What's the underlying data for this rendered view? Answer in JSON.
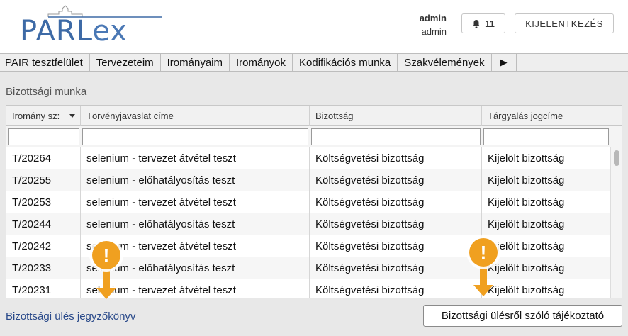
{
  "header": {
    "logo_text_main": "PARL",
    "logo_text_ex": "ex",
    "user_name": "admin",
    "user_role": "admin",
    "notification_count": "11",
    "logout_label": "KIJELENTKEZÉS",
    "icons": {
      "notification": "bell-icon",
      "logo": "parliament-building-icon"
    }
  },
  "nav": {
    "items": [
      "PAIR tesztfelület",
      "Tervezeteim",
      "Irományaim",
      "Irományok",
      "Kodifikációs munka",
      "Szakvélemények",
      "▶"
    ]
  },
  "section": {
    "title": "Bizottsági munka"
  },
  "grid": {
    "columns": [
      "Iromány sz:",
      "Törvényjavaslat címe",
      "Bizottság",
      "Tárgyalás jogcíme"
    ],
    "sort_icon": "sort-desc-caret-icon",
    "rows": [
      [
        "T/20264",
        "selenium - tervezet átvétel teszt",
        "Költségvetési bizottság",
        "Kijelölt bizottság"
      ],
      [
        "T/20255",
        "selenium - előhatályosítás teszt",
        "Költségvetési bizottság",
        "Kijelölt bizottság"
      ],
      [
        "T/20253",
        "selenium - tervezet átvétel teszt",
        "Költségvetési bizottság",
        "Kijelölt bizottság"
      ],
      [
        "T/20244",
        "selenium - előhatályosítás teszt",
        "Költségvetési bizottság",
        "Kijelölt bizottság"
      ],
      [
        "T/20242",
        "selenium - tervezet átvétel teszt",
        "Költségvetési bizottság",
        "Kijelölt bizottság"
      ],
      [
        "T/20233",
        "selenium - előhatályosítás teszt",
        "Költségvetési bizottság",
        "Kijelölt bizottság"
      ],
      [
        "T/20231",
        "selenium - tervezet átvétel teszt",
        "Költségvetési bizottság",
        "Kijelölt bizottság"
      ]
    ]
  },
  "footer": {
    "link_label": "Bizottsági ülés jegyzőkönyv",
    "action_label": "Bizottsági ülésről szóló tájékoztató"
  },
  "markers": {
    "symbol": "!",
    "icon": "warning-marker-icon",
    "color": "#f0a020"
  }
}
